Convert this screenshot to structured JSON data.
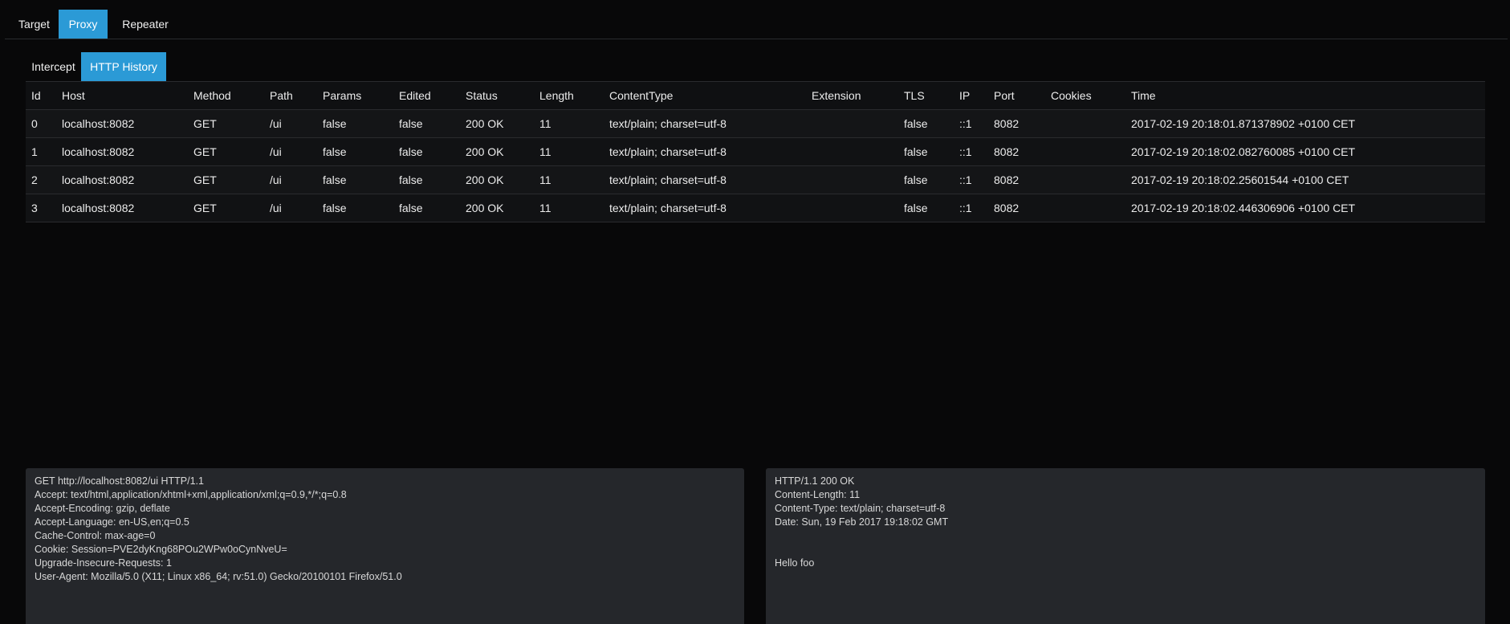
{
  "top_tabs": [
    {
      "label": "Target",
      "active": false
    },
    {
      "label": "Proxy",
      "active": true
    },
    {
      "label": "Repeater",
      "active": false
    }
  ],
  "sub_tabs": [
    {
      "label": "Intercept",
      "active": false
    },
    {
      "label": "HTTP History",
      "active": true
    }
  ],
  "table": {
    "columns": [
      "Id",
      "Host",
      "Method",
      "Path",
      "Params",
      "Edited",
      "Status",
      "Length",
      "ContentType",
      "Extension",
      "TLS",
      "IP",
      "Port",
      "Cookies",
      "Time"
    ],
    "rows": [
      [
        "0",
        "localhost:8082",
        "GET",
        "/ui",
        "false",
        "false",
        "200 OK",
        "11",
        "text/plain; charset=utf-8",
        "",
        "false",
        "::1",
        "8082",
        "",
        "2017-02-19 20:18:01.871378902 +0100 CET"
      ],
      [
        "1",
        "localhost:8082",
        "GET",
        "/ui",
        "false",
        "false",
        "200 OK",
        "11",
        "text/plain; charset=utf-8",
        "",
        "false",
        "::1",
        "8082",
        "",
        "2017-02-19 20:18:02.082760085 +0100 CET"
      ],
      [
        "2",
        "localhost:8082",
        "GET",
        "/ui",
        "false",
        "false",
        "200 OK",
        "11",
        "text/plain; charset=utf-8",
        "",
        "false",
        "::1",
        "8082",
        "",
        "2017-02-19 20:18:02.25601544 +0100 CET"
      ],
      [
        "3",
        "localhost:8082",
        "GET",
        "/ui",
        "false",
        "false",
        "200 OK",
        "11",
        "text/plain; charset=utf-8",
        "",
        "false",
        "::1",
        "8082",
        "",
        "2017-02-19 20:18:02.446306906 +0100 CET"
      ]
    ]
  },
  "request_panel": {
    "lines": [
      "GET http://localhost:8082/ui HTTP/1.1",
      "Accept: text/html,application/xhtml+xml,application/xml;q=0.9,*/*;q=0.8",
      "Accept-Encoding: gzip, deflate",
      "Accept-Language: en-US,en;q=0.5",
      "Cache-Control: max-age=0",
      "Cookie: Session=PVE2dyKng68POu2WPw0oCynNveU=",
      "Upgrade-Insecure-Requests: 1",
      "User-Agent: Mozilla/5.0 (X11; Linux x86_64; rv:51.0) Gecko/20100101 Firefox/51.0"
    ]
  },
  "response_panel": {
    "lines": [
      "HTTP/1.1 200 OK",
      "Content-Length: 11",
      "Content-Type: text/plain; charset=utf-8",
      "Date: Sun, 19 Feb 2017 19:18:02 GMT",
      "",
      "",
      "Hello foo"
    ]
  },
  "colors": {
    "background": "#080809",
    "accent": "#2b9ad6",
    "panel": "#25272b"
  }
}
